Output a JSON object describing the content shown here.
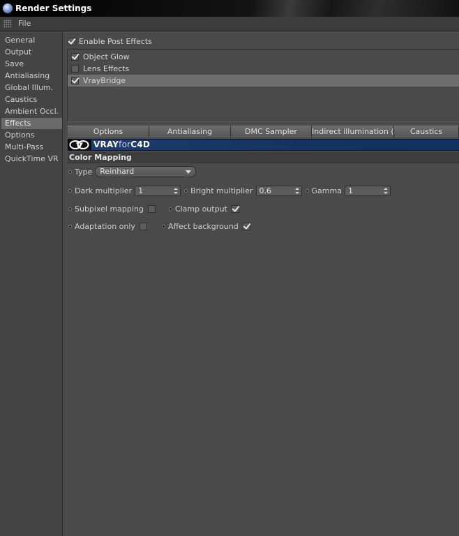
{
  "window": {
    "title": "Render Settings",
    "icon": "cinema4d-app-icon"
  },
  "menubar": {
    "grip_icon": "grip-dots-icon",
    "file_label": "File"
  },
  "sidebar": {
    "items": [
      {
        "label": "General",
        "active": false
      },
      {
        "label": "Output",
        "active": false
      },
      {
        "label": "Save",
        "active": false
      },
      {
        "label": "Antialiasing",
        "active": false
      },
      {
        "label": "Global Illum.",
        "active": false
      },
      {
        "label": "Caustics",
        "active": false
      },
      {
        "label": "Ambient Occl.",
        "active": false
      },
      {
        "label": "Effects",
        "active": true
      },
      {
        "label": "Options",
        "active": false
      },
      {
        "label": "Multi-Pass",
        "active": false
      },
      {
        "label": "QuickTime VR",
        "active": false
      }
    ]
  },
  "effects": {
    "enable_label": "Enable Post Effects",
    "enable_checked": true,
    "list": [
      {
        "label": "Object Glow",
        "checked": true,
        "selected": false
      },
      {
        "label": "Lens Effects",
        "checked": false,
        "selected": false
      },
      {
        "label": "VrayBridge",
        "checked": true,
        "selected": true
      }
    ]
  },
  "tabs": [
    {
      "label": "Options"
    },
    {
      "label": "Antialiasing"
    },
    {
      "label": "DMC Sampler"
    },
    {
      "label": "Indirect illumination (GI)"
    },
    {
      "label": "Caustics"
    }
  ],
  "banner": {
    "logo_icon": "vray-logo-icon",
    "brand_a": "VRAY",
    "brand_b": "for",
    "brand_c": "C4D",
    "color": "#1f3d6e"
  },
  "color_mapping": {
    "header": "Color Mapping",
    "type_label": "Type",
    "type_value": "Reinhard",
    "dark_multiplier_label": "Dark multiplier",
    "dark_multiplier_value": "1",
    "bright_multiplier_label": "Bright multiplier",
    "bright_multiplier_value": "0.6",
    "gamma_label": "Gamma",
    "gamma_value": "1",
    "subpixel_mapping_label": "Subpixel mapping",
    "subpixel_mapping_checked": false,
    "clamp_output_label": "Clamp output",
    "clamp_output_checked": true,
    "adaptation_only_label": "Adaptation only",
    "adaptation_only_checked": false,
    "affect_background_label": "Affect background",
    "affect_background_checked": true
  }
}
